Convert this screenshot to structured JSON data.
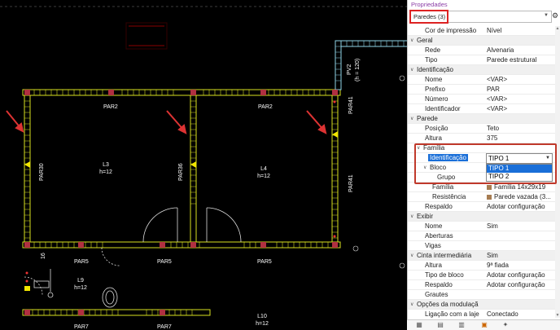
{
  "panel": {
    "title": "Propriedades",
    "selector": "Paredes (3)",
    "rows": [
      {
        "type": "prop",
        "label": "Cor de impressão",
        "value": "Nível"
      },
      {
        "type": "cat",
        "label": "Geral"
      },
      {
        "type": "prop",
        "label": "Rede",
        "value": "Alvenaria"
      },
      {
        "type": "prop",
        "label": "Tipo",
        "value": "Parede estrutural"
      },
      {
        "type": "cat",
        "label": "Identificação"
      },
      {
        "type": "prop",
        "label": "Nome",
        "value": "<VAR>"
      },
      {
        "type": "prop",
        "label": "Prefixo",
        "value": "PAR"
      },
      {
        "type": "prop",
        "label": "Número",
        "value": "<VAR>"
      },
      {
        "type": "prop",
        "label": "Identificador",
        "value": "<VAR>"
      },
      {
        "type": "cat",
        "label": "Parede"
      },
      {
        "type": "prop",
        "label": "Posição",
        "value": "Teto"
      },
      {
        "type": "prop",
        "label": "Altura",
        "value": "375"
      },
      {
        "type": "subcat",
        "label": "Família"
      },
      {
        "type": "sel",
        "label": "Identificação",
        "value": ""
      },
      {
        "type": "subcat2",
        "label": "Bloco"
      },
      {
        "type": "sub2",
        "label": "Grupo",
        "value": ""
      },
      {
        "type": "sub",
        "label": "Família",
        "value": "Família 14x29x19",
        "icon": true
      },
      {
        "type": "sub",
        "label": "Resistência",
        "value": "Parede vazada (3...",
        "icon": true
      },
      {
        "type": "prop",
        "label": "Respaldo",
        "value": "Adotar configuração"
      },
      {
        "type": "cat",
        "label": "Exibir"
      },
      {
        "type": "prop",
        "label": "Nome",
        "value": "Sim"
      },
      {
        "type": "prop",
        "label": "Aberturas",
        "value": ""
      },
      {
        "type": "prop",
        "label": "Vigas",
        "value": ""
      },
      {
        "type": "cat",
        "label": "Cinta intermediária",
        "value": "Sim"
      },
      {
        "type": "prop",
        "label": "Altura",
        "value": "9ª fiada"
      },
      {
        "type": "prop",
        "label": "Tipo de bloco",
        "value": "Adotar configuração"
      },
      {
        "type": "prop",
        "label": "Respaldo",
        "value": "Adotar configuração"
      },
      {
        "type": "prop",
        "label": "Grautes",
        "value": ""
      },
      {
        "type": "cat",
        "label": "Opções da modulação"
      },
      {
        "type": "prop",
        "label": "Ligação com a laje",
        "value": "Conectado"
      }
    ],
    "dropdown": {
      "current": "TIPO 1",
      "options": [
        "TIPO 1",
        "TIPO 2"
      ],
      "highlighted": 0
    },
    "accent_color": "#1a6fd8",
    "outline_color": "#d22"
  },
  "drawing": {
    "wall_labels": {
      "par2_a": "PAR2",
      "par2_b": "PAR2",
      "par5_a": "PAR5",
      "par5_b": "PAR5",
      "par5_c": "PAR5",
      "par7_a": "PAR7",
      "par7_b": "PAR7",
      "par30": "PAR30",
      "par36": "PAR36",
      "par41_a": "PAR41",
      "par41_b": "PAR41",
      "pv2": "PV2",
      "pv2_h": "(h = 120)",
      "small_16": "16"
    },
    "rooms": [
      {
        "name": "L3",
        "h": "h=12"
      },
      {
        "name": "L4",
        "h": "h=12"
      },
      {
        "name": "L9",
        "h": "h=12"
      },
      {
        "name": "L10",
        "h": "h=12"
      }
    ],
    "room_l10_suffix": "h=12"
  },
  "toolbar": [
    "grid-icon",
    "layers-icon",
    "table-icon",
    "properties-icon",
    "pin-icon"
  ]
}
